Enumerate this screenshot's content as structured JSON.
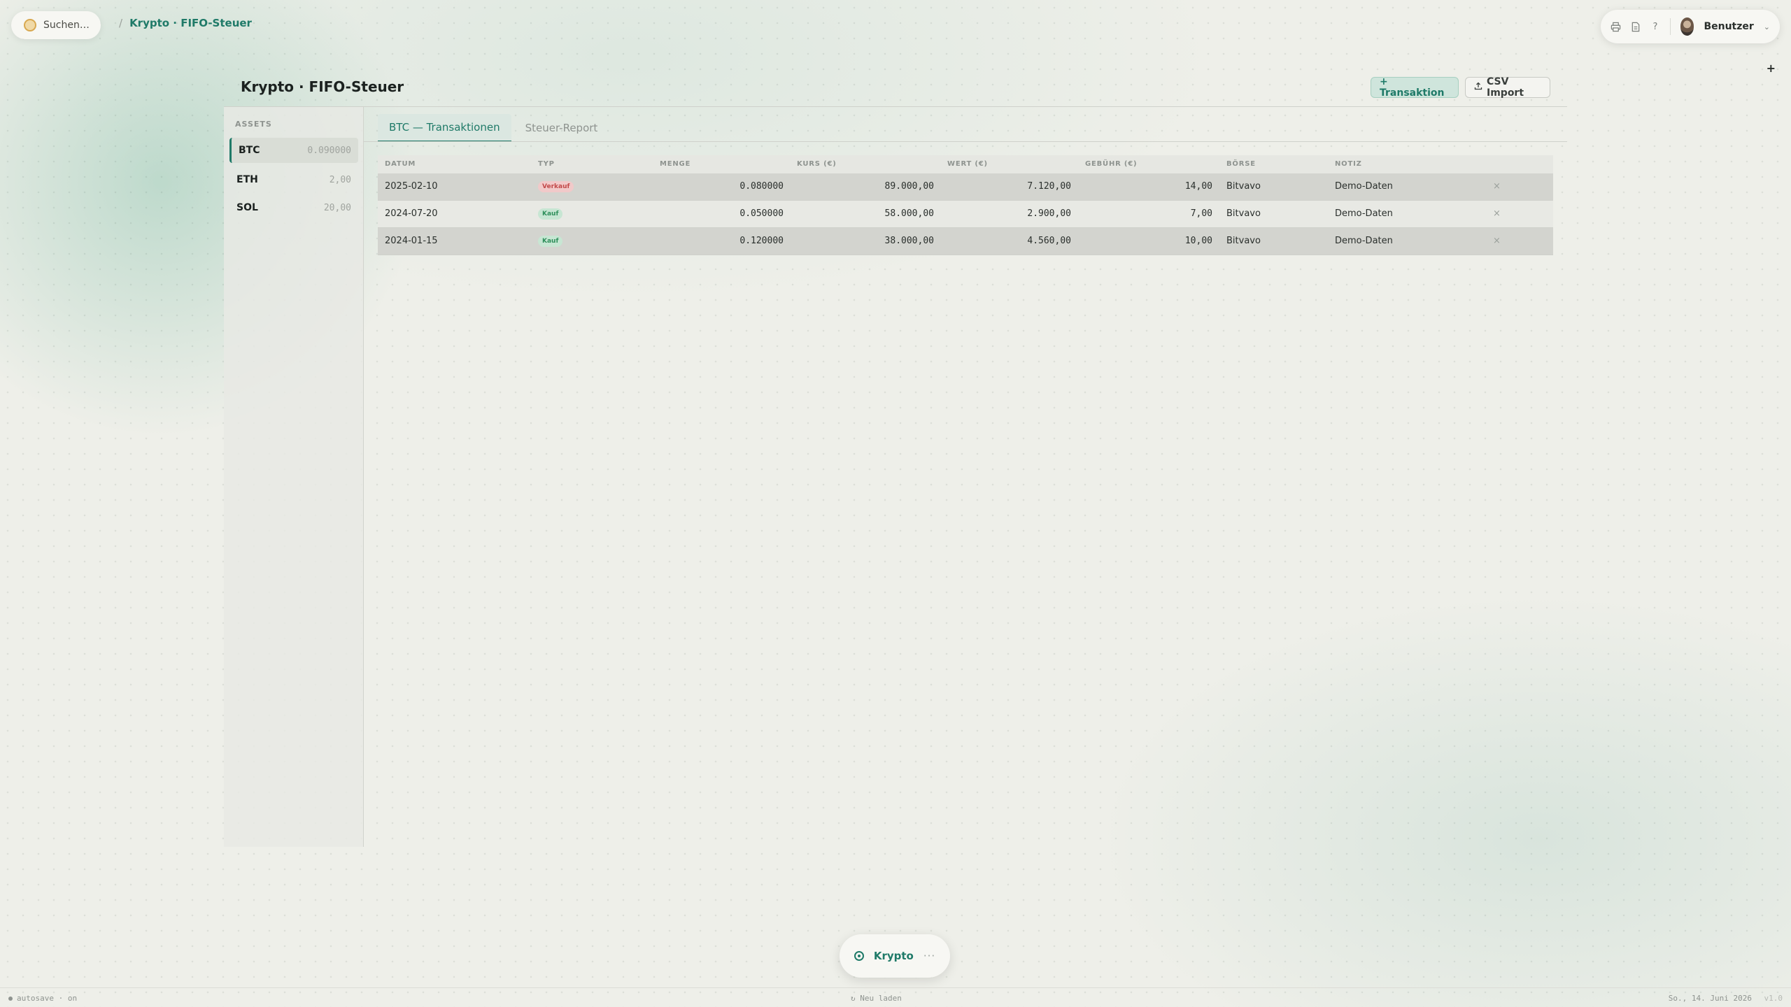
{
  "header": {
    "search_label": "Suchen…",
    "breadcrumb_sep": "/",
    "breadcrumb_current": "Krypto · FIFO-Steuer",
    "user_name": "Benutzer",
    "icons": [
      "printer-icon",
      "document-icon",
      "help-icon"
    ],
    "help_glyph": "?"
  },
  "page": {
    "title": "Krypto · FIFO-Steuer",
    "add_button": "+ Transaktion",
    "csv_button": "CSV Import",
    "corner_plus": "+"
  },
  "sidebar": {
    "section_label": "ASSETS",
    "assets": [
      {
        "symbol": "BTC",
        "amount": "0.090000",
        "active": true
      },
      {
        "symbol": "ETH",
        "amount": "2,00",
        "active": false
      },
      {
        "symbol": "SOL",
        "amount": "20,00",
        "active": false
      }
    ]
  },
  "tabs": [
    {
      "label": "BTC — Transaktionen",
      "active": true
    },
    {
      "label": "Steuer-Report",
      "active": false
    }
  ],
  "table": {
    "headers": [
      "DATUM",
      "TYP",
      "MENGE",
      "KURS (€)",
      "WERT (€)",
      "GEBÜHR (€)",
      "BÖRSE",
      "NOTIZ"
    ],
    "rows": [
      {
        "datum": "2025-02-10",
        "typ": "Verkauf",
        "typ_kind": "sell",
        "menge": "0.080000",
        "kurs": "89.000,00",
        "wert": "7.120,00",
        "gebuehr": "14,00",
        "boerse": "Bitvavo",
        "notiz": "Demo-Daten",
        "delete": "×"
      },
      {
        "datum": "2024-07-20",
        "typ": "Kauf",
        "typ_kind": "buy",
        "menge": "0.050000",
        "kurs": "58.000,00",
        "wert": "2.900,00",
        "gebuehr": "7,00",
        "boerse": "Bitvavo",
        "notiz": "Demo-Daten",
        "delete": "×"
      },
      {
        "datum": "2024-01-15",
        "typ": "Kauf",
        "typ_kind": "buy",
        "menge": "0.120000",
        "kurs": "38.000,00",
        "wert": "4.560,00",
        "gebuehr": "10,00",
        "boerse": "Bitvavo",
        "notiz": "Demo-Daten",
        "delete": "×"
      }
    ]
  },
  "dock": {
    "label": "Krypto",
    "more": "···"
  },
  "statusbar": {
    "left": "autosave · on",
    "center": "↻ Neu laden",
    "right": "So., 14. Juni 2026",
    "version": "v1.0"
  },
  "colors": {
    "accent": "#1f7a68",
    "sell_badge": "#f1c9c9",
    "buy_badge": "#c7e6d3",
    "background": "#eeefe9"
  }
}
